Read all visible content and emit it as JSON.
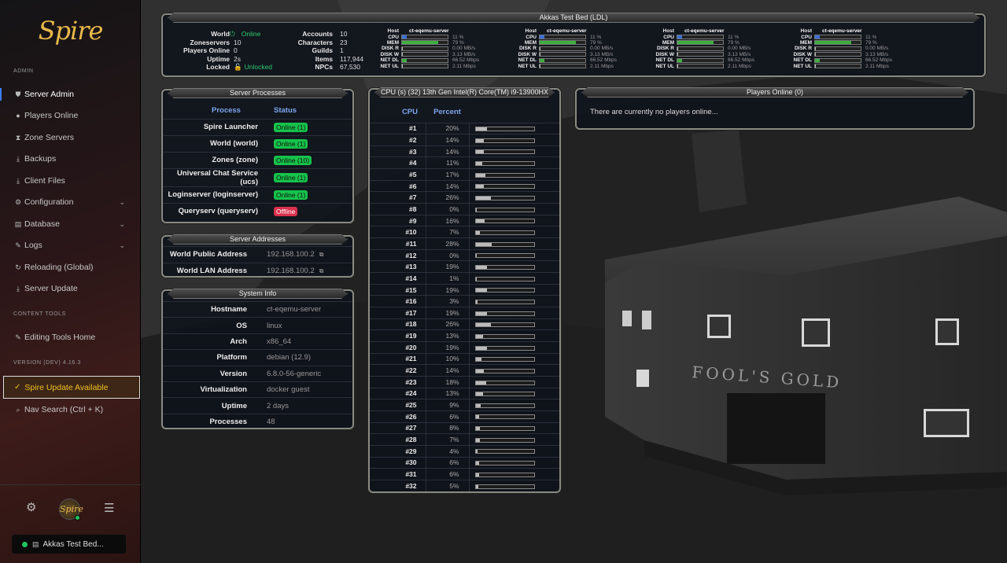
{
  "app": {
    "brand": "Spire"
  },
  "sidebar": {
    "sections": {
      "admin": "ADMIN",
      "content": "CONTENT TOOLS",
      "version": "VERSION (DEV) 4.16.3"
    },
    "items": [
      {
        "label": "Server Admin",
        "icon": "shield-icon"
      },
      {
        "label": "Players Online",
        "icon": "users-icon"
      },
      {
        "label": "Zone Servers",
        "icon": "hourglass-icon"
      },
      {
        "label": "Backups",
        "icon": "download-icon"
      },
      {
        "label": "Client Files",
        "icon": "download-icon"
      },
      {
        "label": "Configuration",
        "icon": "gear-icon"
      },
      {
        "label": "Database",
        "icon": "database-icon"
      },
      {
        "label": "Logs",
        "icon": "pen-icon"
      },
      {
        "label": "Reloading (Global)",
        "icon": "refresh-icon"
      },
      {
        "label": "Server Update",
        "icon": "download-icon"
      }
    ],
    "content_items": [
      {
        "label": "Editing Tools Home",
        "icon": "pen-icon"
      }
    ],
    "update": {
      "label": "Spire Update Available"
    },
    "search": {
      "label": "Nav Search (Ctrl + K)"
    },
    "footer": {
      "server_name": "Akkas Test Bed...",
      "avatar_text": "Spire"
    }
  },
  "top": {
    "title": "Akkas Test Bed (LDL)",
    "left": [
      {
        "k": "World",
        "v": "Online"
      },
      {
        "k": "Zoneservers",
        "v": "10"
      },
      {
        "k": "Players Online",
        "v": "0"
      },
      {
        "k": "Uptime",
        "v": "2s"
      },
      {
        "k": "Locked",
        "v": "Unlocked"
      }
    ],
    "mid": [
      {
        "k": "Accounts",
        "v": "10"
      },
      {
        "k": "Characters",
        "v": "23"
      },
      {
        "k": "Guilds",
        "v": "1"
      },
      {
        "k": "Items",
        "v": "117,944"
      },
      {
        "k": "NPCs",
        "v": "67,530"
      }
    ],
    "host_label": "Host",
    "hosts": [
      "ct-eqemu-server",
      "ct-eqemu-server",
      "ct-eqemu-server",
      "ct-eqemu-server"
    ],
    "metrics": [
      {
        "label": "CPU",
        "value": "11 %",
        "level": 0.11,
        "color": "#3a6fd8"
      },
      {
        "label": "MEM",
        "value": "79 %",
        "level": 0.79,
        "color": "#3fae3f"
      },
      {
        "label": "DISK R",
        "value": "0.00 MB/s",
        "level": 0.0,
        "color": "#bbbbbb"
      },
      {
        "label": "DISK W",
        "value": "3.13 MB/s",
        "level": 0.02,
        "color": "#bbbbbb"
      },
      {
        "label": "NET DL",
        "value": "66.52 Mbps",
        "level": 0.1,
        "color": "#3fae3f"
      },
      {
        "label": "NET UL",
        "value": "2.11 Mbps",
        "level": 0.01,
        "color": "#bbbbbb"
      }
    ]
  },
  "processes": {
    "title": "Server Processes",
    "headers": {
      "process": "Process",
      "status": "Status"
    },
    "rows": [
      {
        "name": "Spire Launcher",
        "status": "Online (1)",
        "online": true
      },
      {
        "name": "World (world)",
        "status": "Online (1)",
        "online": true
      },
      {
        "name": "Zones (zone)",
        "status": "Online (10)",
        "online": true
      },
      {
        "name": "Universal Chat Service (ucs)",
        "status": "Online (1)",
        "online": true
      },
      {
        "name": "Loginserver (loginserver)",
        "status": "Online (1)",
        "online": true
      },
      {
        "name": "Queryserv (queryserv)",
        "status": "Offline",
        "online": false
      }
    ]
  },
  "addresses": {
    "title": "Server Addresses",
    "rows": [
      {
        "k": "World Public Address",
        "v": "192.168.100.2"
      },
      {
        "k": "World LAN Address",
        "v": "192.168.100.2"
      }
    ]
  },
  "sysinfo": {
    "title": "System Info",
    "rows": [
      {
        "k": "Hostname",
        "v": "ct-eqemu-server"
      },
      {
        "k": "OS",
        "v": "linux"
      },
      {
        "k": "Arch",
        "v": "x86_64"
      },
      {
        "k": "Platform",
        "v": "debian (12.9)"
      },
      {
        "k": "Version",
        "v": "6.8.0-56-generic"
      },
      {
        "k": "Virtualization",
        "v": "docker guest"
      },
      {
        "k": "Uptime",
        "v": "2 days"
      },
      {
        "k": "Processes",
        "v": "48"
      }
    ]
  },
  "cpu": {
    "title": "CPU (s) (32) 13th Gen Intel(R) Core(TM) i9-13900HX",
    "headers": {
      "cpu": "CPU",
      "percent": "Percent"
    },
    "rows": [
      {
        "id": "#1",
        "pct": "20%",
        "level": 0.2
      },
      {
        "id": "#2",
        "pct": "14%",
        "level": 0.14
      },
      {
        "id": "#3",
        "pct": "14%",
        "level": 0.14
      },
      {
        "id": "#4",
        "pct": "11%",
        "level": 0.11
      },
      {
        "id": "#5",
        "pct": "17%",
        "level": 0.17
      },
      {
        "id": "#6",
        "pct": "14%",
        "level": 0.14
      },
      {
        "id": "#7",
        "pct": "26%",
        "level": 0.26
      },
      {
        "id": "#8",
        "pct": "0%",
        "level": 0.0
      },
      {
        "id": "#9",
        "pct": "16%",
        "level": 0.16
      },
      {
        "id": "#10",
        "pct": "7%",
        "level": 0.07
      },
      {
        "id": "#11",
        "pct": "28%",
        "level": 0.28
      },
      {
        "id": "#12",
        "pct": "0%",
        "level": 0.0
      },
      {
        "id": "#13",
        "pct": "19%",
        "level": 0.19
      },
      {
        "id": "#14",
        "pct": "1%",
        "level": 0.01
      },
      {
        "id": "#15",
        "pct": "19%",
        "level": 0.19
      },
      {
        "id": "#16",
        "pct": "3%",
        "level": 0.03
      },
      {
        "id": "#17",
        "pct": "19%",
        "level": 0.19
      },
      {
        "id": "#18",
        "pct": "26%",
        "level": 0.26
      },
      {
        "id": "#19",
        "pct": "13%",
        "level": 0.13
      },
      {
        "id": "#20",
        "pct": "19%",
        "level": 0.19
      },
      {
        "id": "#21",
        "pct": "10%",
        "level": 0.1
      },
      {
        "id": "#22",
        "pct": "14%",
        "level": 0.14
      },
      {
        "id": "#23",
        "pct": "18%",
        "level": 0.18
      },
      {
        "id": "#24",
        "pct": "13%",
        "level": 0.13
      },
      {
        "id": "#25",
        "pct": "9%",
        "level": 0.09
      },
      {
        "id": "#26",
        "pct": "6%",
        "level": 0.06
      },
      {
        "id": "#27",
        "pct": "8%",
        "level": 0.08
      },
      {
        "id": "#28",
        "pct": "7%",
        "level": 0.07
      },
      {
        "id": "#29",
        "pct": "4%",
        "level": 0.04
      },
      {
        "id": "#30",
        "pct": "6%",
        "level": 0.06
      },
      {
        "id": "#31",
        "pct": "6%",
        "level": 0.06
      },
      {
        "id": "#32",
        "pct": "5%",
        "level": 0.05
      }
    ]
  },
  "players": {
    "title": "Players Online (0)",
    "empty": "There are currently no players online..."
  },
  "background": {
    "sign_text": "FOOL'S GOLD"
  }
}
